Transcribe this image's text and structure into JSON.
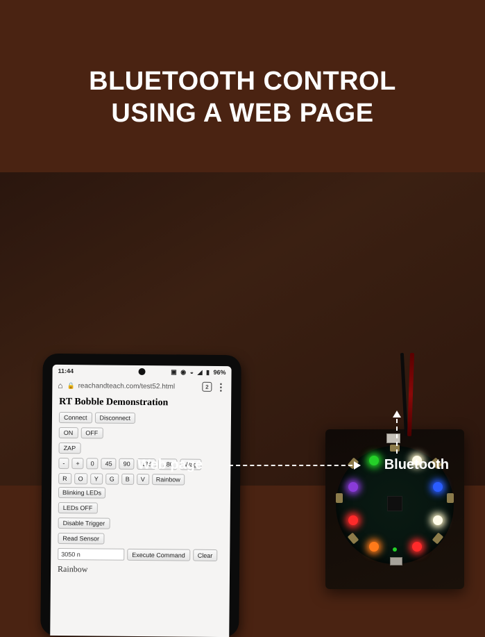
{
  "headline": {
    "line1": "BLUETOOTH CONTROL",
    "line2": "USING A WEB PAGE"
  },
  "phone": {
    "status": {
      "time": "11:44",
      "battery": "96%"
    },
    "browser": {
      "url": "reachandteach.com/test52.html",
      "tabcount": "2"
    },
    "page": {
      "title": "RT Bobble Demonstration",
      "rows": {
        "connect": {
          "connect": "Connect",
          "disconnect": "Disconnect"
        },
        "onoff": {
          "on": "ON",
          "off": "OFF"
        },
        "zap": {
          "zap": "ZAP"
        },
        "angles": {
          "dec": "-",
          "inc": "+",
          "a0": "0",
          "a45": "45",
          "a90": "90",
          "a135": "135",
          "a180": "180",
          "wag": "Wag"
        },
        "colors": {
          "r": "R",
          "o": "O",
          "y": "Y",
          "g": "G",
          "b": "B",
          "v": "V",
          "rainbow": "Rainbow",
          "blinking": "Blinking LEDs"
        },
        "ledsoff": {
          "ledsoff": "LEDs OFF"
        },
        "trigger": {
          "disable": "Disable Trigger"
        },
        "sensor": {
          "read": "Read Sensor"
        },
        "cmd": {
          "value": "3050 n",
          "exec": "Execute Command",
          "clear": "Clear"
        }
      },
      "status": "Rainbow"
    }
  },
  "labels": {
    "web": "Web page",
    "bluetooth": "Bluetooth"
  }
}
